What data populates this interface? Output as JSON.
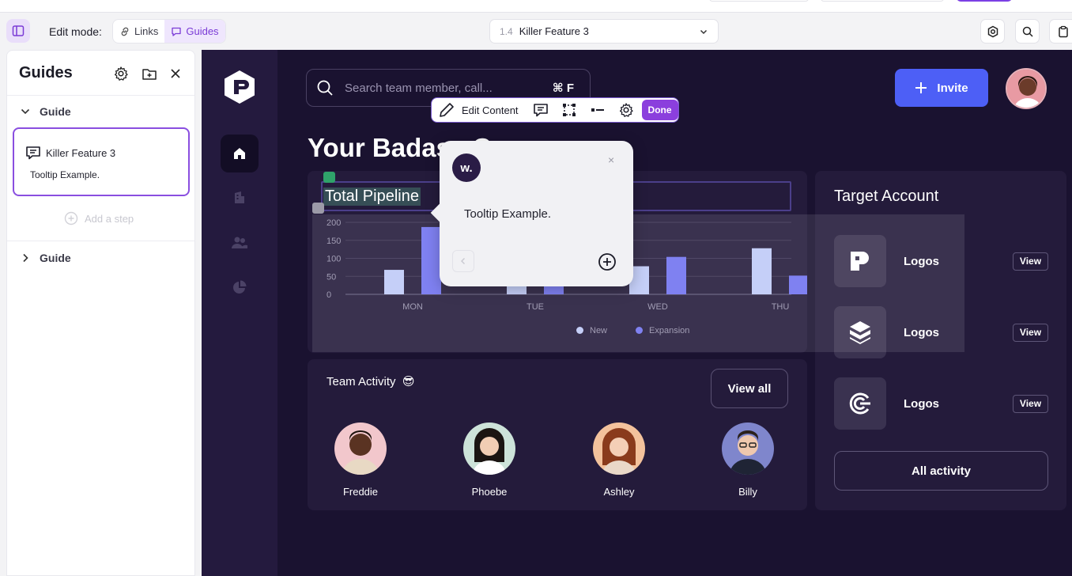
{
  "toolbar": {
    "edit_mode_label": "Edit mode:",
    "links_label": "Links",
    "guides_label": "Guides",
    "step_number": "1.4",
    "step_title": "Killer Feature 3"
  },
  "guides_panel": {
    "title": "Guides",
    "group1_label": "Guide",
    "step_title": "Killer Feature 3",
    "step_description": "Tooltip Example.",
    "add_step_label": "Add a step",
    "group2_label": "Guide"
  },
  "app": {
    "search_placeholder": "Search team member, call...",
    "search_shortcut": "⌘ F",
    "invite_label": "Invite",
    "page_heading": "Your Badass Co",
    "pipeline_title": "Total Pipeline",
    "team_title": "Team Activity",
    "team_emoji": "😎",
    "view_all_label": "View all",
    "team_members": [
      "Freddie",
      "Phoebe",
      "Ashley",
      "Billy"
    ],
    "account_title": "Target Account",
    "accounts": [
      {
        "name": "Logos",
        "action": "View"
      },
      {
        "name": "Logos",
        "action": "View"
      },
      {
        "name": "Logos",
        "action": "View"
      }
    ],
    "all_activity_label": "All activity"
  },
  "edit_bar": {
    "edit_content_label": "Edit Content",
    "done_label": "Done"
  },
  "tooltip": {
    "logo_text": "w.",
    "close": "×",
    "text": "Tooltip Example."
  },
  "chart_data": {
    "type": "bar",
    "categories": [
      "MON",
      "TUE",
      "WED",
      "THU"
    ],
    "series": [
      {
        "name": "New",
        "values": [
          68,
          30,
          78,
          128
        ]
      },
      {
        "name": "Expansion",
        "values": [
          187,
          30,
          104,
          52
        ]
      }
    ],
    "yticks": [
      0,
      50,
      100,
      150,
      200
    ],
    "ylim": [
      0,
      200
    ],
    "legend_position": "bottom",
    "colors": {
      "New": "#bfcaf8",
      "Expansion": "#7173f0"
    }
  },
  "colors": {
    "accent": "#8b3fdd",
    "invite": "#4d5ff6",
    "app_bg": "#1a1230"
  }
}
